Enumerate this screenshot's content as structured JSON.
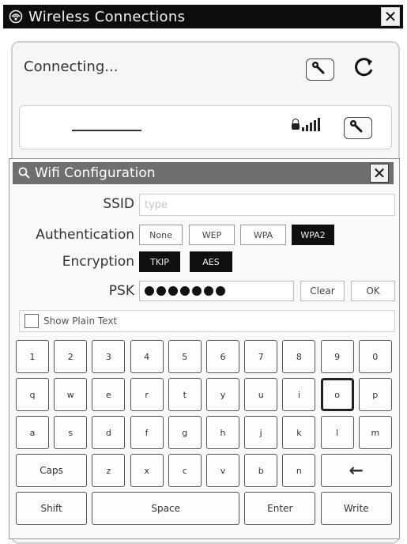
{
  "window": {
    "title": "Wireless Connections",
    "close_glyph": "✕"
  },
  "status": {
    "text": "Connecting..."
  },
  "network": {
    "lock_icon": "lock-icon",
    "signal_icon": "signal-bars-icon"
  },
  "dialog": {
    "title": "Wifi Configuration",
    "close_glyph": "✕",
    "ssid_label": "SSID",
    "ssid_placeholder": "type",
    "auth_label": "Authentication",
    "auth_options": [
      "None",
      "WEP",
      "WPA",
      "WPA2"
    ],
    "auth_selected": "WPA2",
    "enc_label": "Encryption",
    "enc_options": [
      "TKIP",
      "AES"
    ],
    "psk_label": "PSK",
    "psk_mask_count": 7,
    "clear_label": "Clear",
    "ok_label": "OK",
    "show_plain_label": "Show Plain Text"
  },
  "keyboard": {
    "row1": [
      "1",
      "2",
      "3",
      "4",
      "5",
      "6",
      "7",
      "8",
      "9",
      "0"
    ],
    "row2": [
      "q",
      "w",
      "e",
      "r",
      "t",
      "y",
      "u",
      "i",
      "o",
      "p"
    ],
    "row3": [
      "a",
      "s",
      "d",
      "f",
      "g",
      "h",
      "j",
      "k",
      "l",
      "m"
    ],
    "row4": [
      "Caps",
      "z",
      "x",
      "c",
      "v",
      "b",
      "n",
      "←"
    ],
    "row5": [
      "Shift",
      "Space",
      "Enter",
      "Write"
    ],
    "focused_key": "o"
  },
  "colors": {
    "titlebar": "#0d0d0d",
    "dialog_title": "#6f6f6f",
    "selected_option": "#0f0f0f"
  }
}
